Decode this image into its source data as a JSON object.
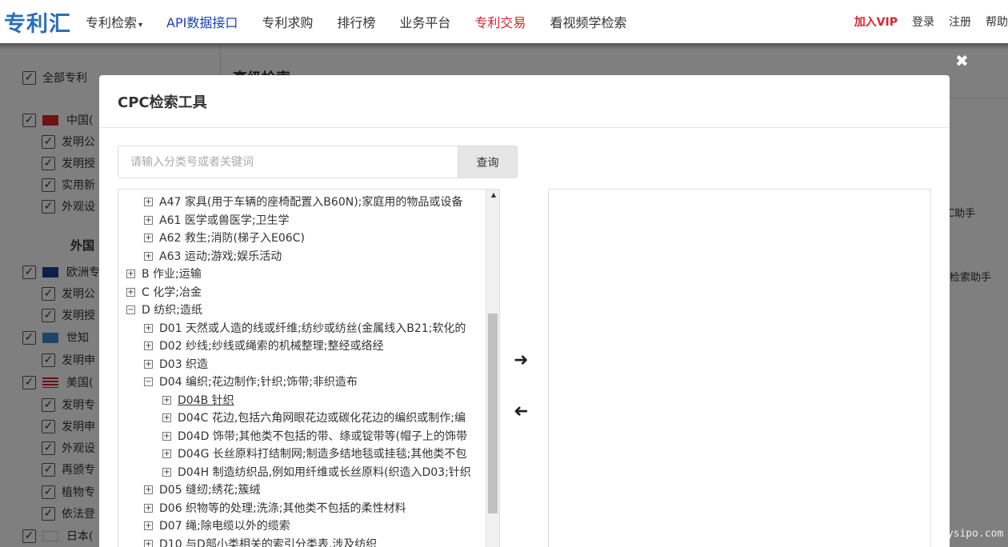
{
  "nav": {
    "logo": "专利汇",
    "items": [
      {
        "label": "专利检索",
        "caret": "▾"
      },
      {
        "label": "API数据接口"
      },
      {
        "label": "专利求购"
      },
      {
        "label": "排行榜"
      },
      {
        "label": "业务平台"
      },
      {
        "label": "专利交易"
      },
      {
        "label": "看视频学检索"
      }
    ],
    "vip": "加入VIP",
    "login": "登录",
    "register": "注册",
    "help": "帮助"
  },
  "sidebar": {
    "all_label": "全部专利",
    "foreign_head": "外国",
    "rows": [
      {
        "label": "中国(",
        "flag": "cn"
      },
      {
        "label": "发明公"
      },
      {
        "label": "发明授"
      },
      {
        "label": "实用新"
      },
      {
        "label": "外观设"
      },
      {
        "label": "欧洲专",
        "flag": "eu"
      },
      {
        "label": "发明公"
      },
      {
        "label": "发明授"
      },
      {
        "label": "世知",
        "flag": "wo"
      },
      {
        "label": "发明申"
      },
      {
        "label": "美国(",
        "flag": "us"
      },
      {
        "label": "发明专"
      },
      {
        "label": "发明申"
      },
      {
        "label": "外观设"
      },
      {
        "label": "再颁专"
      },
      {
        "label": "植物专"
      },
      {
        "label": "依法登"
      },
      {
        "label": "日本(",
        "flag": "jp"
      }
    ]
  },
  "background_main": {
    "title": "高级检索",
    "peek1": "C助手",
    "peek2": "你检索助手"
  },
  "modal": {
    "title": "CPC检索工具",
    "close": "✖",
    "search": {
      "placeholder": "请输入分类号或者关键词",
      "button": "查询"
    },
    "arrow_right": "➜",
    "arrow_left": "➜",
    "tree": [
      {
        "code": "A47",
        "label": "A47 家具(用于车辆的座椅配置入B60N);家庭用的物品或设备",
        "toggle": "+"
      },
      {
        "code": "A61",
        "label": "A61 医学或兽医学;卫生学",
        "toggle": "+"
      },
      {
        "code": "A62",
        "label": "A62 救生;消防(梯子入E06C)",
        "toggle": "+"
      },
      {
        "code": "A63",
        "label": "A63 运动;游戏;娱乐活动",
        "toggle": "+"
      },
      {
        "code": "B",
        "label": "B 作业;运输",
        "toggle": "+"
      },
      {
        "code": "C",
        "label": "C 化学;冶金",
        "toggle": "+"
      },
      {
        "code": "D",
        "label": "D 纺织;造纸",
        "toggle": "−"
      },
      {
        "code": "D01",
        "label": "D01 天然或人造的线或纤维;纺纱或纺丝(金属线入B21;软化的",
        "toggle": "+"
      },
      {
        "code": "D02",
        "label": "D02 纱线;纱线或绳索的机械整理;整经或络经",
        "toggle": "+"
      },
      {
        "code": "D03",
        "label": "D03 织造",
        "toggle": "+"
      },
      {
        "code": "D04",
        "label": "D04 编织;花边制作;针织;饰带;非织造布",
        "toggle": "−"
      },
      {
        "code": "D04B",
        "label": "D04B 针织",
        "toggle": "+"
      },
      {
        "code": "D04C",
        "label": "D04C 花边,包括六角网眼花边或碳化花边的编织或制作;编",
        "toggle": "+"
      },
      {
        "code": "D04D",
        "label": "D04D 饰带;其他类不包括的带、绦或锭带等(帽子上的饰带",
        "toggle": "+"
      },
      {
        "code": "D04G",
        "label": "D04G 长丝原料打结制网;制造多结地毯或挂毯;其他类不包",
        "toggle": "+"
      },
      {
        "code": "D04H",
        "label": "D04H 制造纺织品,例如用纤维或长丝原料(织造入D03;针织",
        "toggle": "+"
      },
      {
        "code": "D05",
        "label": "D05 缝纫;绣花;簇绒",
        "toggle": "+"
      },
      {
        "code": "D06",
        "label": "D06 织物等的处理;洗涤;其他类不包括的柔性材料",
        "toggle": "+"
      },
      {
        "code": "D07",
        "label": "D07 绳;除电缆以外的缆索",
        "toggle": "+"
      },
      {
        "code": "D10",
        "label": "D10 与D部小类相关的索引分类表,涉及纺织",
        "toggle": "+"
      }
    ]
  },
  "watermark": "mysipo.com"
}
